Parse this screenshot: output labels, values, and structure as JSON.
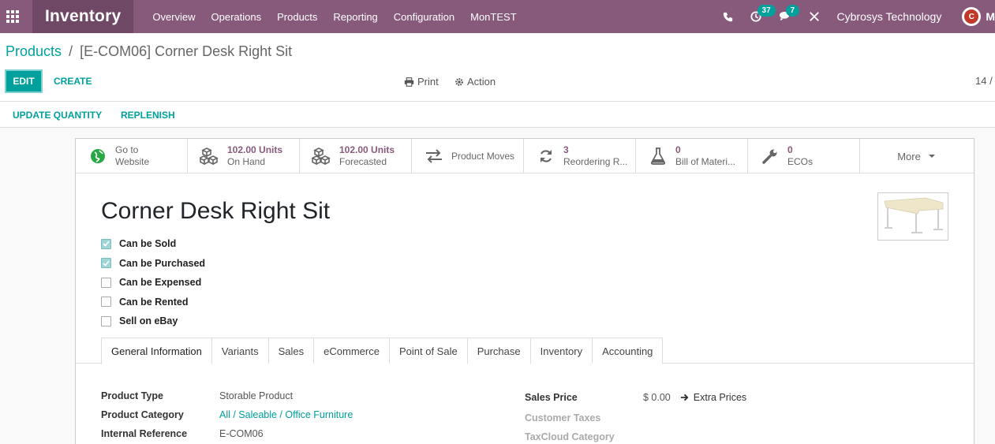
{
  "navbar": {
    "app_title": "Inventory",
    "menu": [
      "Overview",
      "Operations",
      "Products",
      "Reporting",
      "Configuration",
      "MonTEST"
    ],
    "activity_count": "37",
    "messages_count": "7",
    "company": "Cybrosys Technology",
    "user_initial": "M",
    "avatar_letter": "C"
  },
  "breadcrumb": {
    "parent": "Products",
    "separator": "/",
    "current": "[E-COM06] Corner Desk Right Sit"
  },
  "buttons": {
    "edit": "EDIT",
    "create": "CREATE",
    "print": "Print",
    "action": "Action",
    "pager": "14 /"
  },
  "statusbar": {
    "update_quantity": "UPDATE QUANTITY",
    "replenish": "REPLENISH"
  },
  "smart_buttons": [
    {
      "num": "Go to",
      "label": "Website",
      "icon": "globe-icon"
    },
    {
      "num": "102.00 Units",
      "label": "On Hand",
      "icon": "cubes-icon"
    },
    {
      "num": "102.00 Units",
      "label": "Forecasted",
      "icon": "cubes-icon"
    },
    {
      "num": "",
      "label": "Product Moves",
      "icon": "exchange-icon"
    },
    {
      "num": "3",
      "label": "Reordering R...",
      "icon": "refresh-icon"
    },
    {
      "num": "0",
      "label": "Bill of Materi...",
      "icon": "flask-icon"
    },
    {
      "num": "0",
      "label": "ECOs",
      "icon": "wrench-icon"
    }
  ],
  "more_label": "More",
  "product": {
    "name": "Corner Desk Right Sit"
  },
  "checkboxes": [
    {
      "label": "Can be Sold",
      "checked": true
    },
    {
      "label": "Can be Purchased",
      "checked": true
    },
    {
      "label": "Can be Expensed",
      "checked": false
    },
    {
      "label": "Can be Rented",
      "checked": false
    },
    {
      "label": "Sell on eBay",
      "checked": false
    }
  ],
  "tabs": [
    "General Information",
    "Variants",
    "Sales",
    "eCommerce",
    "Point of Sale",
    "Purchase",
    "Inventory",
    "Accounting"
  ],
  "fields_left": [
    {
      "label": "Product Type",
      "value": "Storable Product"
    },
    {
      "label": "Product Category",
      "value": "All / Saleable / Office Furniture"
    },
    {
      "label": "Internal Reference",
      "value": "E-COM06"
    }
  ],
  "fields_right": {
    "sales_price_label": "Sales Price",
    "sales_price": "$ 0.00",
    "extra_prices": "Extra Prices",
    "customer_taxes": "Customer Taxes",
    "taxcloud_category": "TaxCloud Category"
  },
  "colors": {
    "navbar": "#875a7b",
    "brand_bg": "#6f4866",
    "accent": "#00a09d"
  }
}
